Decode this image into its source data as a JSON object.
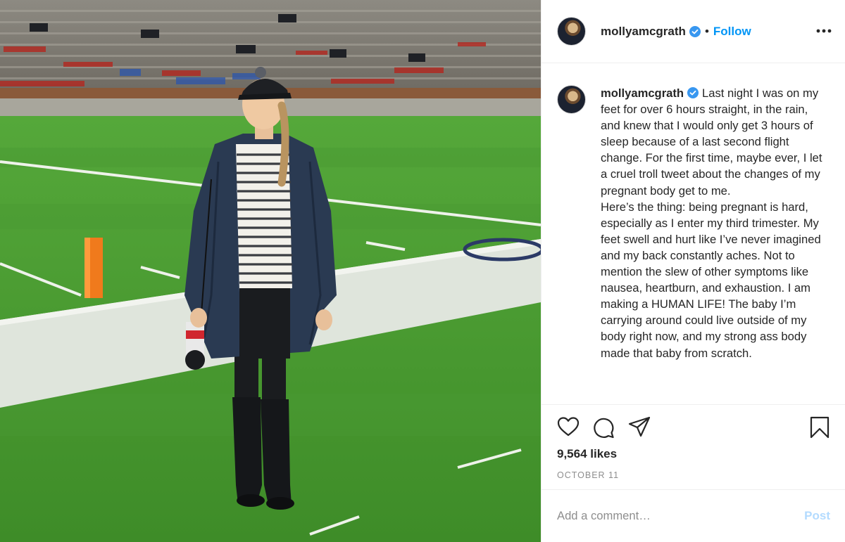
{
  "colors": {
    "accent": "#0095f6",
    "post_disabled": "#b3dbff",
    "verified": "#3897f0",
    "text": "#262626",
    "muted": "#8e8e8e"
  },
  "header": {
    "username": "mollyamcgrath",
    "separator": "•",
    "follow_label": "Follow",
    "more_icon": "more-options-icon"
  },
  "caption": {
    "username": "mollyamcgrath",
    "text": "Last night I was on my feet for over 6 hours straight, in the rain, and knew that I would only get 3 hours of sleep because of a last second flight change. For the first time, maybe ever, I let a cruel troll tweet about the changes of my pregnant body get to me.\nHere’s the thing: being pregnant is hard, especially as I enter my third trimester. My feet swell and hurt like I’ve never imagined and my back constantly aches. Not to mention the slew of other symptoms like nausea, heartburn, and exhaustion. I am making a HUMAN LIFE! The baby I’m carrying around could live outside of my body right now, and my strong ass body made that baby from scratch."
  },
  "actions": {
    "icons": [
      "heart-icon",
      "comment-icon",
      "share-icon",
      "bookmark-icon"
    ],
    "likes": "9,564 likes",
    "date": "OCTOBER 11"
  },
  "comment_box": {
    "placeholder": "Add a comment…",
    "post_label": "Post"
  }
}
